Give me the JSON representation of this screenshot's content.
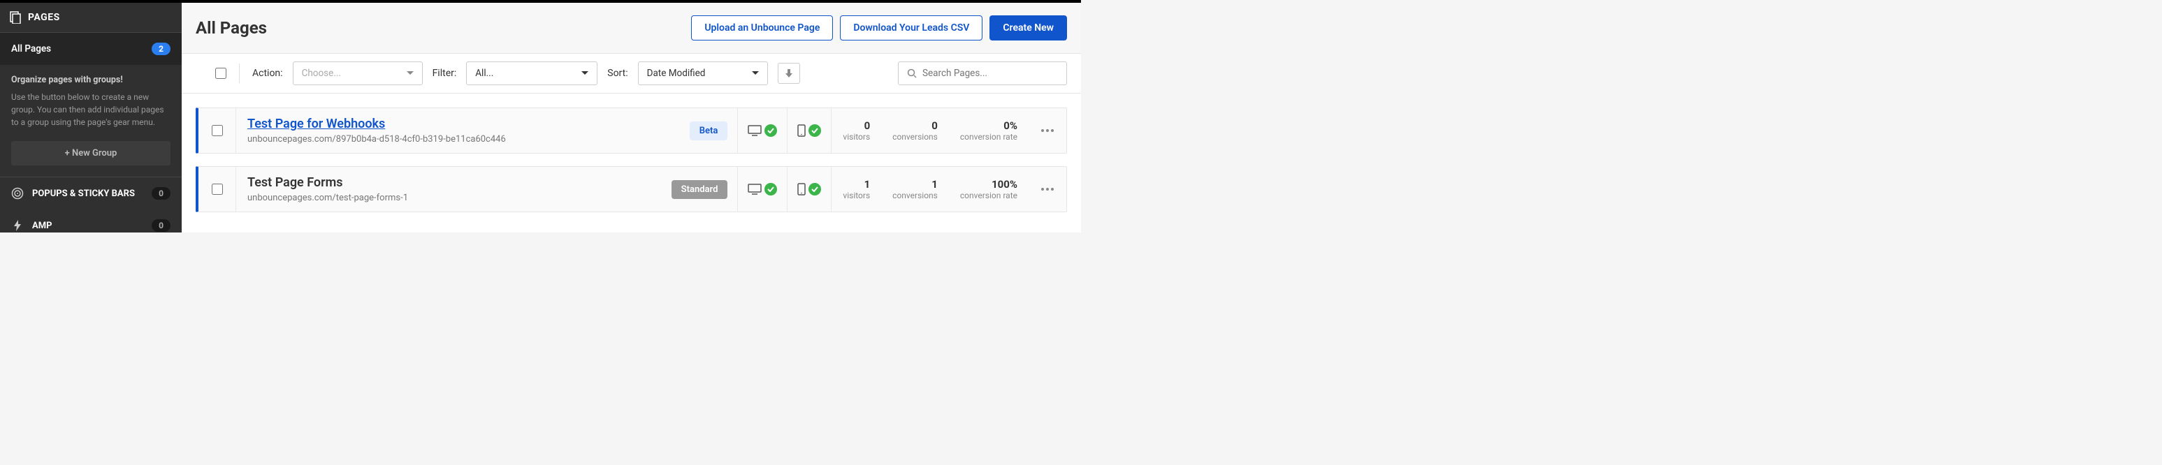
{
  "sidebar": {
    "header": "PAGES",
    "all_pages": {
      "label": "All Pages",
      "count": "2"
    },
    "organize": {
      "title": "Organize pages with groups!",
      "text": "Use the button below to create a new group. You can then add individual pages to a group using the page's gear menu."
    },
    "new_group_btn": "+ New Group",
    "nav": {
      "popups": {
        "label": "POPUPS & STICKY BARS",
        "count": "0"
      },
      "amp": {
        "label": "AMP",
        "count": "0"
      }
    }
  },
  "header": {
    "title": "All Pages",
    "upload": "Upload an Unbounce Page",
    "download": "Download Your Leads CSV",
    "create": "Create New"
  },
  "toolbar": {
    "action_label": "Action:",
    "action_placeholder": "Choose...",
    "filter_label": "Filter:",
    "filter_value": "All...",
    "sort_label": "Sort:",
    "sort_value": "Date Modified",
    "search_placeholder": "Search Pages..."
  },
  "pages": [
    {
      "title": "Test Page for Webhooks",
      "url": "unbouncepages.com/897b0b4a-d518-4cf0-b319-be11ca60c446",
      "badge": "Beta",
      "badge_type": "beta",
      "link": true,
      "visitors": "0",
      "conversions": "0",
      "rate": "0%"
    },
    {
      "title": "Test Page Forms",
      "url": "unbouncepages.com/test-page-forms-1",
      "badge": "Standard",
      "badge_type": "standard",
      "link": false,
      "visitors": "1",
      "conversions": "1",
      "rate": "100%"
    }
  ],
  "labels": {
    "visitors": "visitors",
    "conversions": "conversions",
    "rate": "conversion rate"
  }
}
